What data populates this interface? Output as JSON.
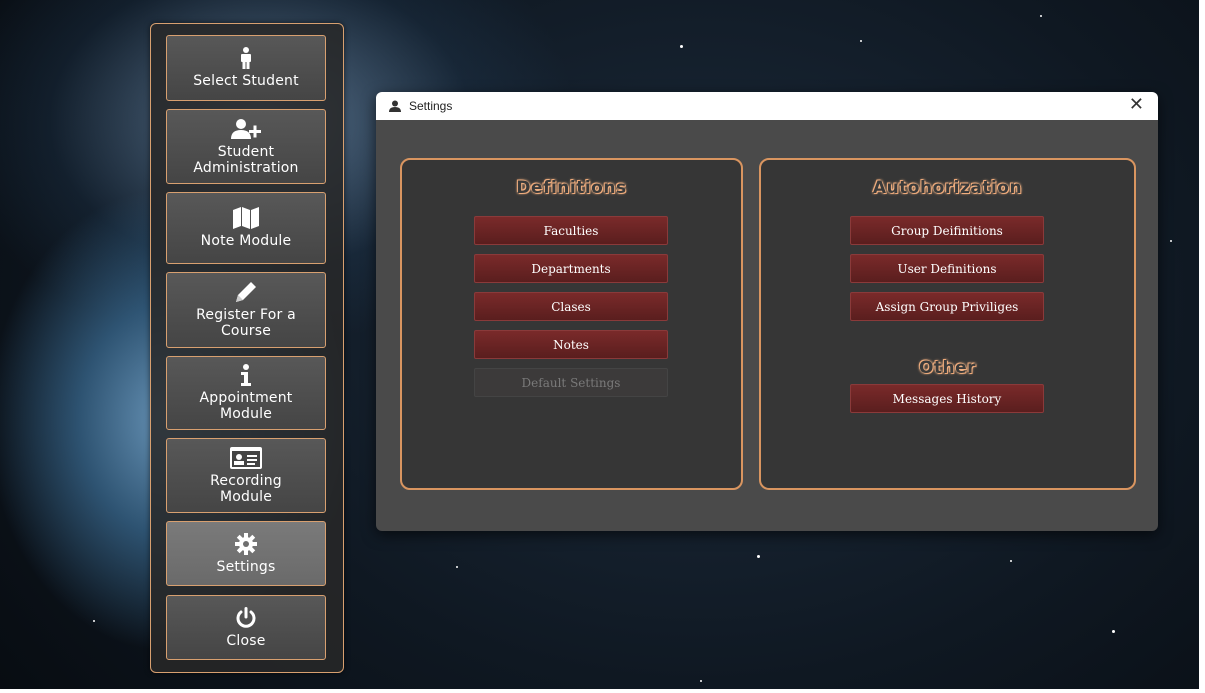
{
  "sidebar": {
    "items": [
      {
        "label": "Select Student",
        "icon": "person-icon"
      },
      {
        "label": "Student\nAdministration",
        "icon": "add-user-icon"
      },
      {
        "label": "Note Module",
        "icon": "map-icon"
      },
      {
        "label": "Register For a\nCourse",
        "icon": "pencil-icon"
      },
      {
        "label": "Appointment\nModule",
        "icon": "info-icon"
      },
      {
        "label": "Recording\nModule",
        "icon": "id-card-icon"
      },
      {
        "label": "Settings",
        "icon": "gear-icon"
      },
      {
        "label": "Close",
        "icon": "power-icon"
      }
    ]
  },
  "window": {
    "title": "Settings",
    "close_glyph": "✕"
  },
  "definitions": {
    "title": "Definitions",
    "buttons": [
      "Faculties",
      "Departments",
      "Clases",
      "Notes",
      "Default Settings"
    ]
  },
  "authorization": {
    "title": "Autohorization",
    "buttons": [
      "Group Deifinitions",
      "User Definitions",
      "Assign Group Priviliges"
    ]
  },
  "other": {
    "title": "Other",
    "buttons": [
      "Messages History"
    ]
  },
  "colors": {
    "accent_border": "#d99560",
    "action_button": "#6a2424"
  }
}
